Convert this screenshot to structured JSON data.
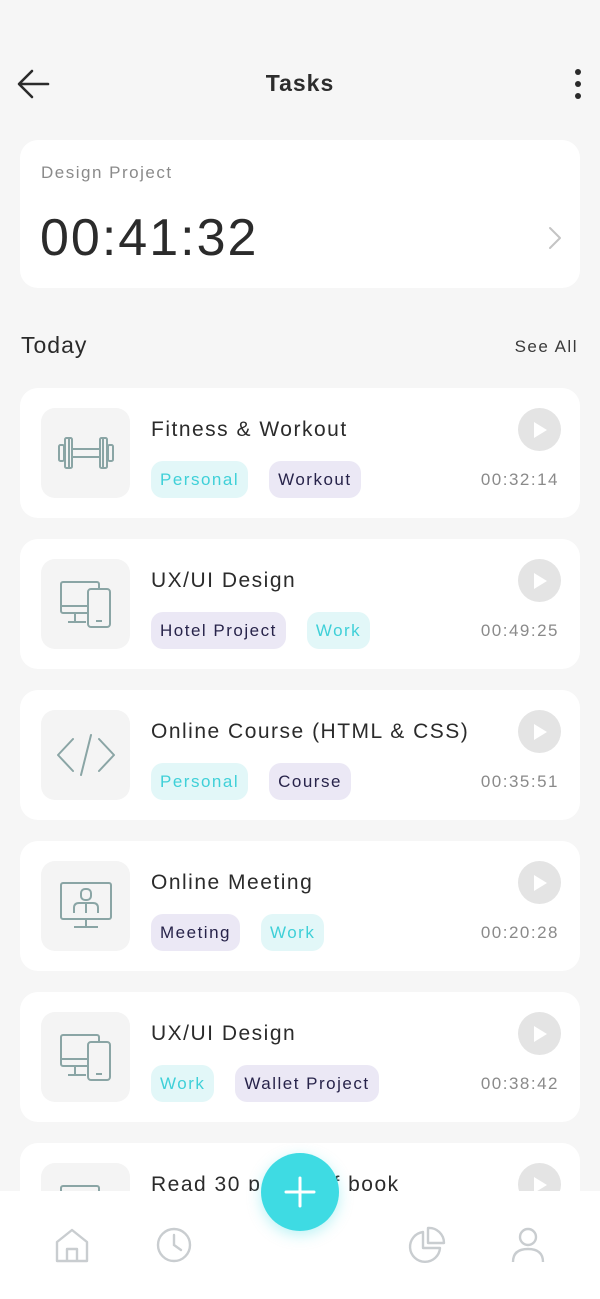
{
  "header": {
    "title": "Tasks",
    "back_icon": "arrow-left-icon",
    "more_icon": "more-vertical-icon"
  },
  "active_timer": {
    "project": "Design Project",
    "time": "00:41:32"
  },
  "section": {
    "title": "Today",
    "see_all": "See All"
  },
  "tasks": [
    {
      "name": "Fitness & Workout",
      "icon": "dumbbell-icon",
      "tags": [
        "Personal",
        "Workout"
      ],
      "duration": "00:32:14"
    },
    {
      "name": "UX/UI Design",
      "icon": "devices-icon",
      "tags": [
        "Hotel Project",
        "Work"
      ],
      "duration": "00:49:25"
    },
    {
      "name": "Online Course (HTML & CSS)",
      "icon": "code-icon",
      "tags": [
        "Personal",
        "Course"
      ],
      "duration": "00:35:51"
    },
    {
      "name": "Online Meeting",
      "icon": "video-meeting-icon",
      "tags": [
        "Meeting",
        "Work"
      ],
      "duration": "00:20:28"
    },
    {
      "name": "UX/UI Design",
      "icon": "devices-icon",
      "tags": [
        "Work",
        "Wallet Project"
      ],
      "duration": "00:38:42"
    },
    {
      "name": "Read 30 pages of book",
      "icon": "devices-icon",
      "tags": [],
      "duration": ""
    }
  ],
  "nav": {
    "items": [
      "home-icon",
      "clock-icon",
      "add-icon",
      "pie-chart-icon",
      "user-icon"
    ]
  },
  "colors": {
    "accent": "#3edbe3",
    "tag_teal_bg": "#e2f7f8",
    "tag_teal_text": "#3fd0d8",
    "tag_purple_bg": "#ebe8f5",
    "tag_purple_text": "#27234a"
  }
}
